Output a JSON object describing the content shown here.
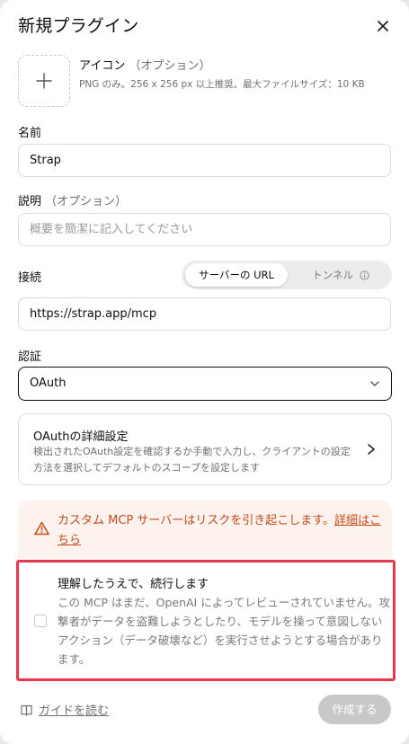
{
  "header": {
    "title": "新規プラグイン"
  },
  "icon_upload": {
    "title": "アイコン",
    "optional": "（オプション）",
    "help": "PNG のみ。256 x 256 px 以上推奨。最大ファイルサイズ：10 KB"
  },
  "name": {
    "label": "名前",
    "value": "Strap"
  },
  "description": {
    "label": "説明",
    "optional": "（オプション）",
    "placeholder": "概要を簡潔に記入してください"
  },
  "connection": {
    "label": "接続",
    "options": [
      "サーバーの URL",
      "トンネル"
    ],
    "selected": "サーバーの URL",
    "url": "https://strap.app/mcp"
  },
  "auth": {
    "label": "認証",
    "selected": "OAuth"
  },
  "oauth_card": {
    "title": "OAuthの詳細設定",
    "description": "検出されたOAuth設定を確認するか手動で入力し、クライアントの設定方法を選択してデフォルトのスコープを設定します"
  },
  "warning": {
    "text": "カスタム MCP サーバーはリスクを引き起こします。",
    "link": "詳細はこちら"
  },
  "acknowledge": {
    "title": "理解したうえで、続行します",
    "description": "この MCP はまだ、OpenAI によってレビューされていません。攻撃者がデータを盗難しようとしたり、モデルを操って意図しないアクション（データ破壊など）を実行させようとする場合があります。",
    "checked": false
  },
  "footer": {
    "guide_link": "ガイドを読む",
    "create_button": "作成する"
  },
  "colors": {
    "warning_text": "#c44a18",
    "warning_bg": "#fdf2ee",
    "highlight_border": "#e8384f",
    "disabled_button": "#c8c8c8"
  }
}
